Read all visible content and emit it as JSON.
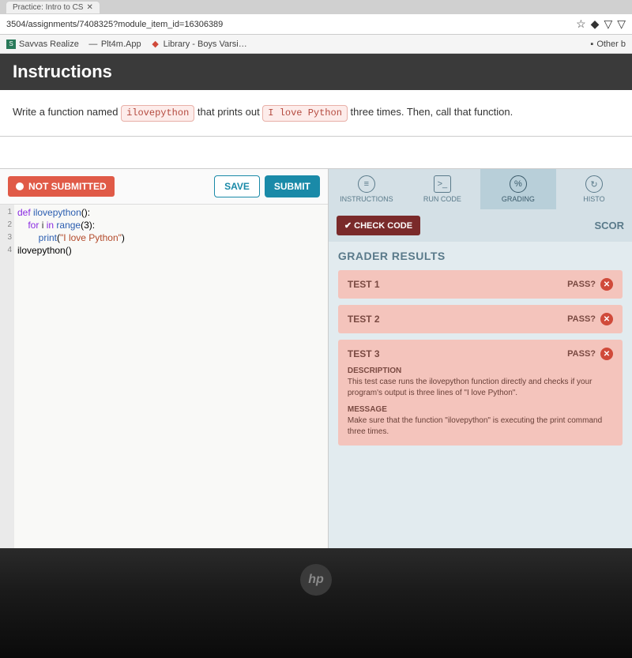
{
  "browser": {
    "tab_title": "Practice: Intro to CS",
    "url": "3504/assignments/7408325?module_item_id=16306389",
    "star_icon": "☆",
    "ext_icon": "◆",
    "dl_icon": "▽"
  },
  "bookmarks": {
    "items": [
      {
        "label": "Savvas Realize",
        "icon_color": "#2a7a5a"
      },
      {
        "label": "Plt4m.App",
        "icon_color": "#333"
      },
      {
        "label": "Library - Boys Varsi…",
        "icon_color": "#d04a3a"
      }
    ],
    "other": "Other b"
  },
  "header": {
    "title": "Instructions"
  },
  "prompt": {
    "pre": "Write a function named ",
    "chip1": "ilovepython",
    "mid": " that prints out ",
    "chip2": "I love Python",
    "post": " three times. Then, call that function."
  },
  "editor": {
    "status": "NOT SUBMITTED",
    "save": "SAVE",
    "submit": "SUBMIT",
    "line_numbers": [
      "1",
      "2",
      "3",
      "4"
    ],
    "code": {
      "l1_def": "def",
      "l1_name": "ilovepython",
      "l1_paren": "():",
      "l2_for": "for",
      "l2_var": "i",
      "l2_in": "in",
      "l2_range": "range",
      "l2_arg": "(3):",
      "l3_print": "print",
      "l3_paren_open": "(",
      "l3_str": "\"I love Python\"",
      "l3_paren_close": ")",
      "l4": "ilovepython()"
    }
  },
  "tabs": {
    "instructions": "INSTRUCTIONS",
    "runcode": "RUN CODE",
    "grading": "GRADING",
    "history": "HISTO"
  },
  "grading": {
    "check": "✔ CHECK CODE",
    "score": "SCOR",
    "results_title": "GRADER RESULTS",
    "pass_label": "PASS?",
    "tests": [
      {
        "name": "TEST 1"
      },
      {
        "name": "TEST 2"
      },
      {
        "name": "TEST 3",
        "desc_label": "DESCRIPTION",
        "desc": "This test case runs the ilovepython function directly and checks if your program's output is three lines of \"I love Python\".",
        "msg_label": "MESSAGE",
        "msg": "Make sure that the function \"ilovepython\" is executing the print command three times."
      }
    ]
  },
  "logo": "hp"
}
